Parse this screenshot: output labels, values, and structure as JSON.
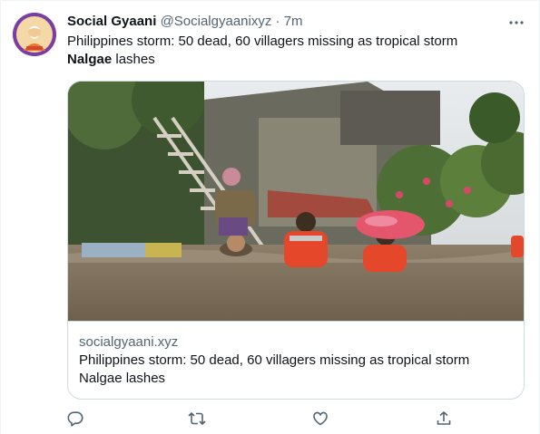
{
  "tweet": {
    "author": {
      "display_name": "Social Gyaani",
      "handle": "@Socialgyaanixyz",
      "separator": "·",
      "time": "7m",
      "avatar_icon": "monk-avatar-icon"
    },
    "text": {
      "part1": "Philippines storm: 50 dead, 60 villagers missing as tropical storm",
      "bold": "Nalgae",
      "part2": " lashes"
    },
    "card": {
      "image_icon": "flood-rescue-photo",
      "domain": "socialgyaani.xyz",
      "title_line1": "Philippines storm: 50 dead, 60 villagers missing as tropical storm",
      "title_line2": "Nalgae lashes"
    },
    "actions": [
      "reply-icon",
      "retweet-icon",
      "like-icon",
      "share-icon"
    ]
  },
  "colors": {
    "text_primary": "#0f1419",
    "text_secondary": "#536471",
    "border": "#cfd9de",
    "icon": "#536471"
  }
}
